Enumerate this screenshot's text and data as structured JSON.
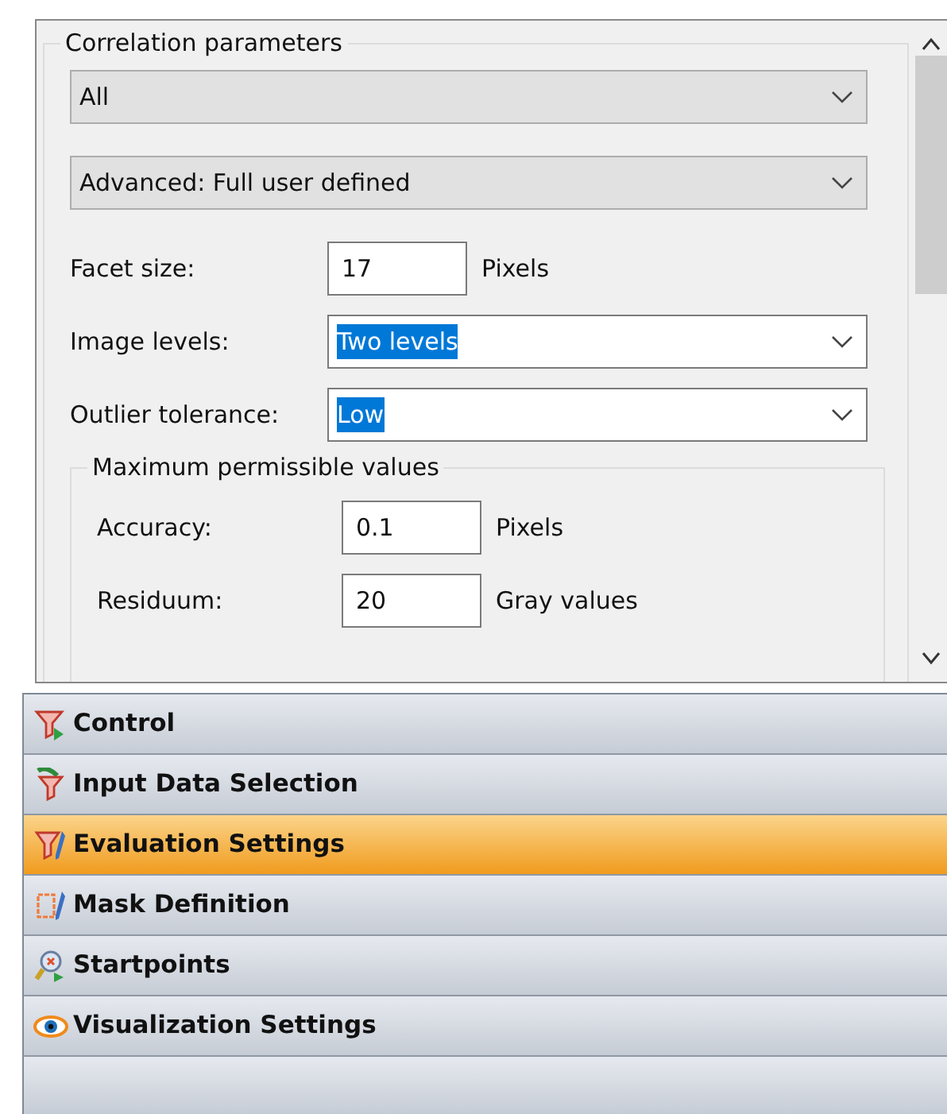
{
  "correlation_parameters": {
    "title": "Correlation parameters",
    "dropdowns": [
      {
        "value": "All",
        "editable": false
      },
      {
        "value": "Advanced: Full user defined",
        "editable": false
      }
    ],
    "fields": [
      {
        "kind": "number",
        "label": "Facet size:",
        "value": "17",
        "unit": "Pixels"
      },
      {
        "kind": "select",
        "label": "Image levels:",
        "value": "Two levels",
        "text_selected": true
      },
      {
        "kind": "select",
        "label": "Outlier tolerance:",
        "value": "Low",
        "text_selected": true
      }
    ],
    "maximum_permissible_values": {
      "title": "Maximum permissible values",
      "fields": [
        {
          "kind": "number",
          "label": "Accuracy:",
          "value": "0.1",
          "unit": "Pixels"
        },
        {
          "kind": "number",
          "label": "Residuum:",
          "value": "20",
          "unit": "Gray values"
        }
      ]
    }
  },
  "navigation": [
    {
      "label": "Control",
      "selected": false
    },
    {
      "label": "Input Data Selection",
      "selected": false
    },
    {
      "label": "Evaluation Settings",
      "selected": true
    },
    {
      "label": "Mask Definition",
      "selected": false
    },
    {
      "label": "Startpoints",
      "selected": false
    },
    {
      "label": "Visualization Settings",
      "selected": false
    }
  ]
}
